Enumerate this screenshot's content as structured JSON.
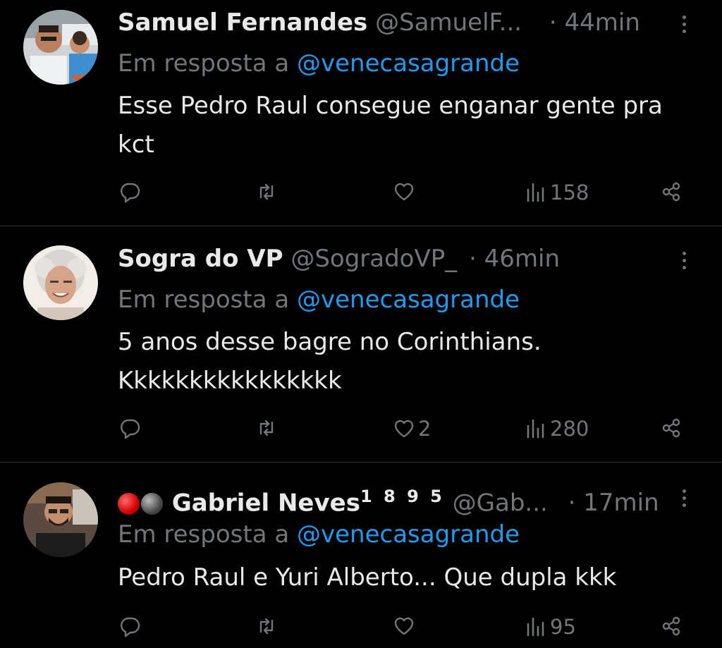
{
  "tweets": [
    {
      "display_name": "Samuel Fernandes",
      "handle": "@SamuelF...",
      "time": "· 44min",
      "reply_prefix": "Em resposta a",
      "reply_to": "@venecasagrande",
      "text": "Esse Pedro Raul consegue enganar gente pra kct",
      "likes": "",
      "views": "158",
      "avatar_icon": "avatar-photo-man-and-child"
    },
    {
      "display_name": "Sogra do VP",
      "handle": "@SogradoVP_",
      "time": "· 46min",
      "reply_prefix": "Em resposta a",
      "reply_to": "@venecasagrande",
      "text": "5 anos desse bagre no Corinthians. Kkkkkkkkkkkkkkkk",
      "likes": "2",
      "views": "280",
      "avatar_icon": "avatar-photo-gray-haired-man"
    },
    {
      "display_name": "Gabriel Neves",
      "name_suffix": "1 8 9 5",
      "handle": "@Gab...",
      "time": "· 17min",
      "reply_prefix": "Em resposta a",
      "reply_to": "@venecasagrande",
      "text": "Pedro Raul e Yuri Alberto... Que dupla kkk",
      "likes": "",
      "views": "95",
      "avatar_icon": "avatar-photo-man-with-glasses",
      "badges": [
        "red-ball",
        "black-ball"
      ]
    }
  ],
  "colors": {
    "background": "#000000",
    "text": "#e7e9ea",
    "muted": "#71767b",
    "link": "#1d9bf0",
    "separator": "#2f3336"
  }
}
